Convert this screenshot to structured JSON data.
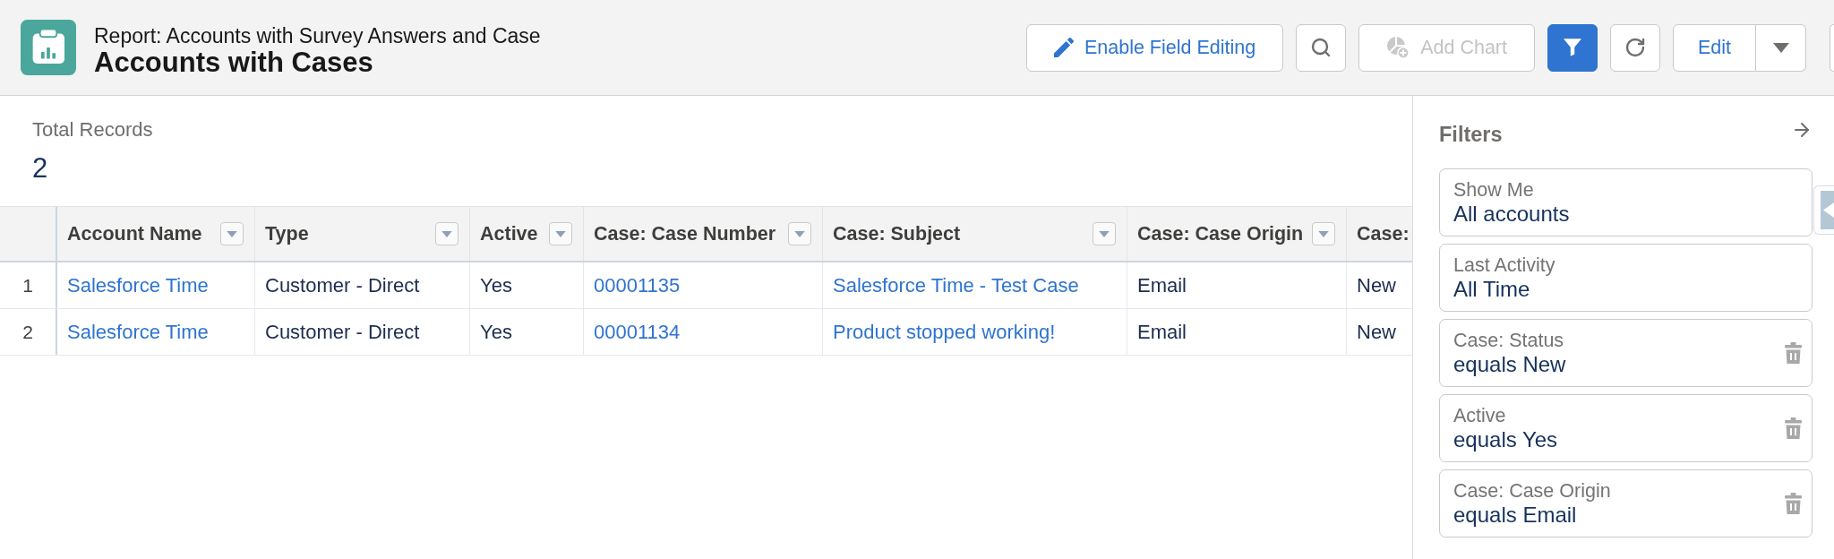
{
  "header": {
    "subtitle": "Report: Accounts with Survey Answers and Case",
    "title": "Accounts with Cases"
  },
  "toolbar": {
    "buttons": [
      {
        "kind": "labeled",
        "label": "Enable Field Editing",
        "disabled": false,
        "selected": false
      },
      {
        "kind": "icon",
        "disabled": false,
        "selected": false
      },
      {
        "kind": "labeled",
        "label": "Add Chart",
        "disabled": true,
        "selected": false
      },
      {
        "kind": "icon",
        "disabled": false,
        "selected": true
      },
      {
        "kind": "icon",
        "disabled": false,
        "selected": false
      },
      {
        "kind": "split",
        "label": "Edit",
        "disabled": false,
        "selected": false
      },
      {
        "kind": "clipped"
      }
    ]
  },
  "summary": {
    "label": "Total Records",
    "value": "2"
  },
  "table": {
    "columns": [
      {
        "label": "Account Name",
        "kind": "link"
      },
      {
        "label": "Type",
        "kind": "text"
      },
      {
        "label": "Active",
        "kind": "text"
      },
      {
        "label": "Case: Case Number",
        "kind": "link"
      },
      {
        "label": "Case: Subject",
        "kind": "link"
      },
      {
        "label": "Case: Case Origin",
        "kind": "text"
      },
      {
        "label": "Case:",
        "kind": "text"
      }
    ],
    "rows": [
      {
        "number": "1",
        "cells": [
          "Salesforce Time",
          "Customer - Direct",
          "Yes",
          "00001135",
          "Salesforce Time - Test Case",
          "Email",
          "New"
        ]
      },
      {
        "number": "2",
        "cells": [
          "Salesforce Time",
          "Customer - Direct",
          "Yes",
          "00001134",
          "Product stopped working!",
          "Email",
          "New"
        ]
      }
    ]
  },
  "filters_panel": {
    "title": "Filters",
    "filters": [
      {
        "label": "Show Me",
        "value": "All accounts",
        "removable": false
      },
      {
        "label": "Last Activity",
        "value": "All Time",
        "removable": false
      },
      {
        "label": "Case: Status",
        "value": "equals New",
        "removable": true
      },
      {
        "label": "Active",
        "value": "equals Yes",
        "removable": true
      },
      {
        "label": "Case: Case Origin",
        "value": "equals Email",
        "removable": true
      }
    ]
  }
}
